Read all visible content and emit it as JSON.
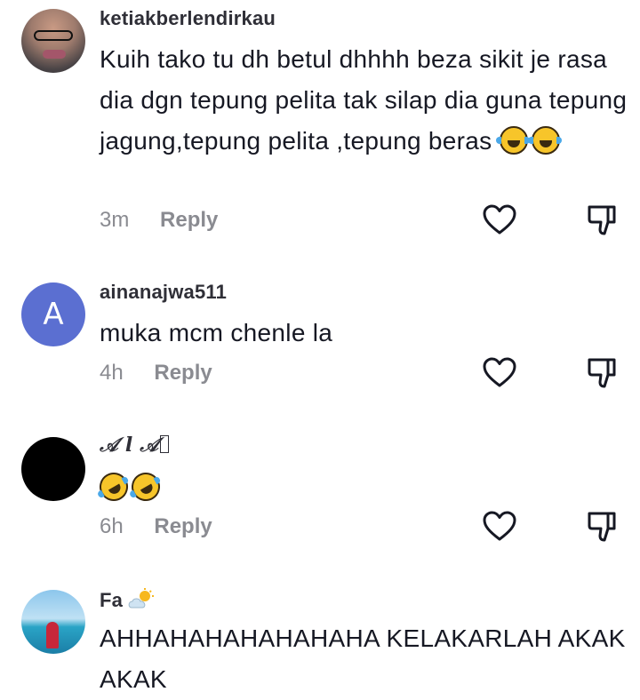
{
  "comments": [
    {
      "username": "ketiakberlendirkau",
      "text": "Kuih tako tu dh betul dhhhh beza sikit je rasa dia dgn tepung pelita tak silap dia guna tepung jagung,tepung pelita ,tepung beras",
      "time": "3m",
      "reply_label": "Reply",
      "avatar": "photo-avatar",
      "emoji": [
        "tears-of-joy-emoji",
        "tears-of-joy-emoji"
      ]
    },
    {
      "username": "ainanajwa511",
      "text": "muka mcm chenle la",
      "time": "4h",
      "reply_label": "Reply",
      "avatar_letter": "A",
      "avatar_color": "#5b6fd1"
    },
    {
      "username": "𝒜 l 𝒜",
      "text": "",
      "time": "6h",
      "reply_label": "Reply",
      "avatar_color": "#000000",
      "emoji": [
        "rolling-on-floor-laughing-emoji",
        "rolling-on-floor-laughing-emoji"
      ]
    },
    {
      "username": "Fa",
      "username_icon": "sun-behind-cloud-icon",
      "text": "AHHAHAHAHAHAHAHA KELAKARLAH AKAK AKAK",
      "avatar": "beach-photo-avatar"
    }
  ],
  "icons": {
    "like": "heart-outline-icon",
    "dislike": "thumbs-down-outline-icon"
  },
  "colors": {
    "text": "#161823",
    "muted": "#8a8b91",
    "username": "#2f2f37"
  }
}
